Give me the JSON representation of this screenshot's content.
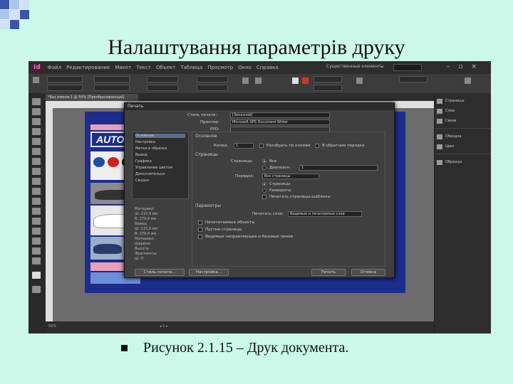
{
  "slide": {
    "title": "Налаштування параметрів друку",
    "caption": "Рисунок 2.1.15 – Друк документа."
  },
  "app": {
    "logo": "Id",
    "menu": [
      "Файл",
      "Редактирование",
      "Макет",
      "Текст",
      "Объект",
      "Таблица",
      "Просмотр",
      "Окно",
      "Справка"
    ],
    "workspace": "Существенные элементы",
    "document_tab": "*Без имени-1 @ 50% [Преобразованный]"
  },
  "canvas": {
    "banner_text": "AUTO"
  },
  "panels": {
    "right_items": [
      "Страницы",
      "Слои",
      "Связи",
      "Обводка",
      "Цвет",
      "Образцы"
    ]
  },
  "dialog": {
    "title": "Печать",
    "preset_label": "Стиль печати:",
    "preset_value": "[Заказной]",
    "printer_label": "Принтер:",
    "printer_value": "Microsoft XPS Document Writer",
    "ppd_label": "PPD:",
    "categories": [
      "Основные",
      "Настройка",
      "Метки и обрезка",
      "Вывод",
      "Графика",
      "Управление цветом",
      "Дополнительно",
      "Сводка"
    ],
    "preview_lines": [
      "Материал:",
      "Ш: 215,9 мм",
      "В: 279,4 мм",
      "Вывод:",
      "Ш: 215,9 мм",
      "В: 279,4 мм",
      "Материал:",
      "Ширина:",
      "Высота:",
      "Фрагменты:",
      "Ш: П"
    ],
    "section_general": "Основное",
    "copies_label": "Копии:",
    "copies_value": "1",
    "collate_label": "Разобрать по копиям",
    "reverse_label": "В обратном порядке",
    "pages_group": "Страницы",
    "pages_label": "Страницы:",
    "all_label": "Все",
    "range_label": "Диапазон:",
    "range_value": "1",
    "sequence_label": "Порядок:",
    "sequence_value": "Все страницы",
    "opt_pages": "Страницы",
    "opt_spreads": "Развороты",
    "opt_master": "Печатать страницы-шаблоны",
    "params_group": "Параметры",
    "layers_label": "Печатать слои:",
    "layers_value": "Видимые и печатаемые слои",
    "opt_nonprint": "Непечатаемые объекты",
    "opt_blank": "Пустые страницы",
    "opt_guides": "Видимые направляющие и базовые линии",
    "btn_setup": "Стиль печати...",
    "btn_printer": "Настройка...",
    "btn_print": "Печать",
    "btn_cancel": "Отмена"
  },
  "colors": {
    "slide_bg": "#ccf8ea",
    "app_bg": "#535353",
    "dialog_bg": "#3f3f3f",
    "page_bg": "#1e2c8c"
  }
}
